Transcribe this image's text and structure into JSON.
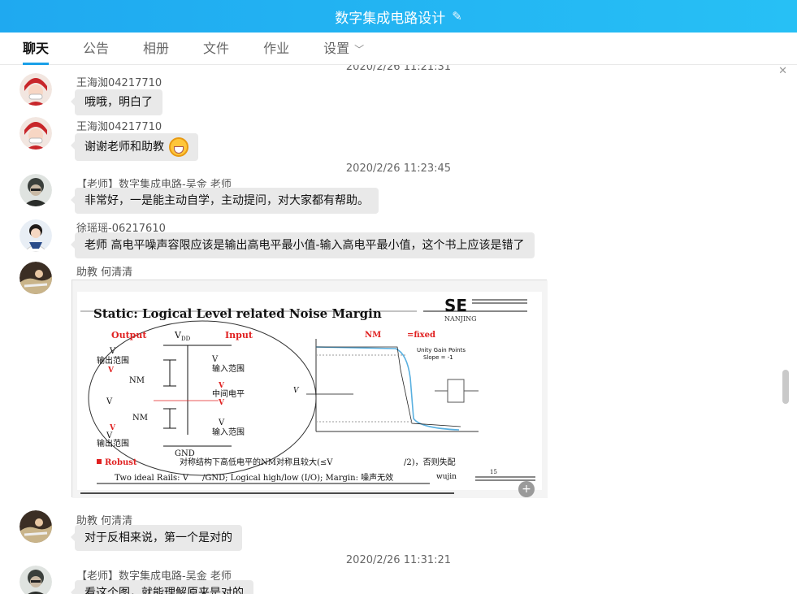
{
  "title": "数字集成电路设计",
  "tabs": [
    {
      "label": "聊天"
    },
    {
      "label": "公告"
    },
    {
      "label": "相册"
    },
    {
      "label": "文件"
    },
    {
      "label": "作业"
    },
    {
      "label": "设置"
    }
  ],
  "timestamps": {
    "t1": "2020/2/26 11:21:31",
    "t2": "2020/2/26 11:23:45",
    "t3": "2020/2/26 11:31:21"
  },
  "messages": [
    {
      "sender": "王海洳04217710",
      "text": "哦哦，明白了"
    },
    {
      "sender": "王海洳04217710",
      "text": "谢谢老师和助教"
    },
    {
      "sender": "【老师】数字集成电路-吴金  老师",
      "text": "非常好，一是能主动自学，主动提问，对大家都有帮助。"
    },
    {
      "sender": "徐瑶瑶-06217610",
      "text": "老师 高电平噪声容限应该是输出高电平最小值-输入高电平最小值，这个书上应该是错了"
    },
    {
      "sender": "助教 何清清",
      "text": ""
    },
    {
      "sender": "助教 何清清",
      "text": "对于反相来说，第一个是对的"
    },
    {
      "sender": "【老师】数字集成电路-吴金  老师",
      "text": "看这个图，就能理解原来是对的"
    }
  ],
  "slide": {
    "heading": "Static: Logical Level related Noise Margin",
    "logo": "SE",
    "logo_sub": "NANJING",
    "col_output": "Output",
    "col_vdd": "V",
    "col_vdd_sub": "DD",
    "col_input": "Input",
    "nm_formula": "NM",
    "nm_formula_rest": "=fixed",
    "unity_gain": "Unity Gain Points",
    "slope": "Slope = -1",
    "voh": "V",
    "out_range": "输出范围",
    "vohmin": "V",
    "nmh": "NM",
    "vdd2": "V",
    "nml": "NM",
    "volmax": "V",
    "vol": "V",
    "out_range2": "输出范围",
    "gnd": "GND",
    "vih": "V",
    "in_range": "输入范围",
    "vihmin": "V",
    "mid_level": "中间电平",
    "vilmax": "V",
    "vil": "V",
    "in_range2": "输入范围",
    "robust": "Robust",
    "sym_note": "对称结构下高低电平的NM对称且较大(≤V",
    "sym_note2": "/2)，否则失配",
    "rails": "Two ideal Rails: V",
    "rails2": " /GND; Logical high/low (I/O);  Margin: 噪声无效",
    "author": "wujin",
    "page": "15"
  },
  "colors": {
    "title_bar": "#1fa9f0",
    "bubble": "#e9e9e9",
    "accent_red": "#e02020"
  },
  "icons": {
    "edit": "pencil-icon",
    "chevron": "chevron-down-icon",
    "zoom": "zoom-in-icon",
    "emoji": "grin-emoji-icon"
  }
}
